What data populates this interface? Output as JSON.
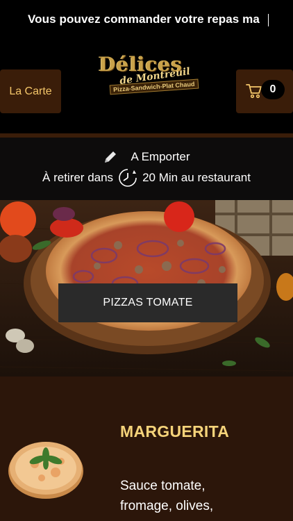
{
  "banner": {
    "text": "Vous pouvez commander votre repas ma"
  },
  "header": {
    "menu_button": "La Carte",
    "cart_count": "0",
    "logo": {
      "main": "Délices",
      "script": "de Montreuil",
      "tagline": "Pizza-Sandwich-Plat Chaud"
    }
  },
  "order_info": {
    "mode": "A Emporter",
    "pickup_prefix": "À retirer dans",
    "pickup_suffix": "20 Min au restaurant"
  },
  "category": {
    "label": "PIZZAS TOMATE"
  },
  "product": {
    "name": "MARGUERITA",
    "description": "Sauce tomate, fromage, olives,"
  },
  "colors": {
    "accent": "#f5d37a",
    "brown": "#3a1d09",
    "product_bg": "#2c160a"
  },
  "icons": [
    "cart-icon",
    "pencil-icon",
    "clock-icon"
  ]
}
